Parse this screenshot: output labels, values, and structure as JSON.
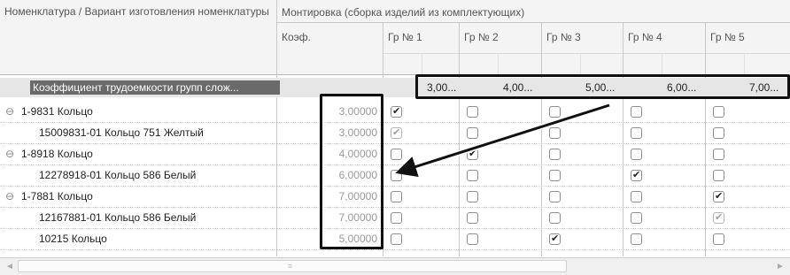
{
  "header": {
    "nomenclature_col": "Номенклатура / Вариант изготовления номенклатуры",
    "operation_group": "Монтировка (сборка изделий из комплектующих)",
    "coef_col": "Коэф.",
    "groups": [
      "Гр № 1",
      "Гр № 2",
      "Гр № 3",
      "Гр № 4",
      "Гр № 5"
    ]
  },
  "coef_row": {
    "label": "Коэффициент трудоемкости групп слож...",
    "values": [
      "3,00...",
      "4,00...",
      "5,00...",
      "6,00...",
      "7,00..."
    ]
  },
  "rows": [
    {
      "name": "1-9831 Кольцо",
      "expandable": true,
      "coef": "3,00000",
      "checks": [
        true,
        false,
        false,
        false,
        false
      ],
      "dim": false
    },
    {
      "name": "15009831-01 Кольцо 751 Желтый",
      "expandable": false,
      "coef": "3,00000",
      "checks": [
        true,
        false,
        false,
        false,
        false
      ],
      "dim": true
    },
    {
      "name": "1-8918 Кольцо",
      "expandable": true,
      "coef": "4,00000",
      "checks": [
        false,
        true,
        false,
        false,
        false
      ],
      "dim": false
    },
    {
      "name": "12278918-01 Кольцо 586 Белый",
      "expandable": false,
      "coef": "6,00000",
      "checks": [
        false,
        false,
        false,
        true,
        false
      ],
      "dim": false
    },
    {
      "name": "1-7881 Кольцо",
      "expandable": true,
      "coef": "7,00000",
      "checks": [
        false,
        false,
        false,
        false,
        true
      ],
      "dim": false
    },
    {
      "name": "12167881-01 Кольцо 586 Белый",
      "expandable": false,
      "coef": "7,00000",
      "checks": [
        false,
        false,
        false,
        false,
        true
      ],
      "dim": true
    },
    {
      "name": "10215 Кольцо",
      "expandable": false,
      "coef": "5,00000",
      "checks": [
        false,
        false,
        true,
        false,
        false
      ],
      "dim": false
    }
  ],
  "icons": {
    "expand": "⊖",
    "check": "✔",
    "scroll_left": "◄",
    "scroll_right": "►",
    "scroll_grip": "≡"
  }
}
